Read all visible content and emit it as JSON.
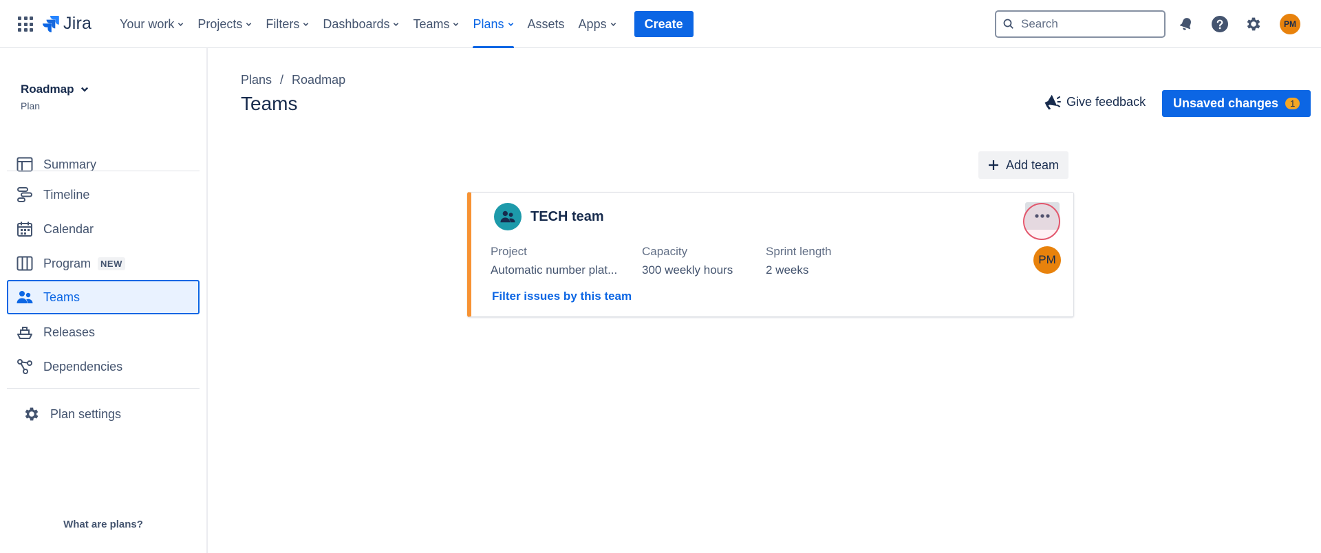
{
  "nav": {
    "logo_text": "Jira",
    "items": [
      {
        "label": "Your work",
        "has_dropdown": true
      },
      {
        "label": "Projects",
        "has_dropdown": true
      },
      {
        "label": "Filters",
        "has_dropdown": true
      },
      {
        "label": "Dashboards",
        "has_dropdown": true
      },
      {
        "label": "Teams",
        "has_dropdown": true
      },
      {
        "label": "Plans",
        "has_dropdown": true,
        "active": true
      },
      {
        "label": "Assets",
        "has_dropdown": false
      },
      {
        "label": "Apps",
        "has_dropdown": true
      }
    ],
    "create_label": "Create",
    "search_placeholder": "Search",
    "user_initials": "PM",
    "icons": [
      "notifications-icon",
      "help-icon",
      "settings-icon"
    ]
  },
  "sidebar": {
    "title": "Roadmap",
    "subtitle": "Plan",
    "items": [
      {
        "label": "Summary",
        "icon": "summary-icon"
      },
      {
        "label": "Timeline",
        "icon": "timeline-icon"
      },
      {
        "label": "Calendar",
        "icon": "calendar-icon"
      },
      {
        "label": "Program",
        "icon": "program-icon",
        "badge": "NEW"
      },
      {
        "label": "Teams",
        "icon": "teams-icon",
        "selected": true
      },
      {
        "label": "Releases",
        "icon": "releases-icon"
      },
      {
        "label": "Dependencies",
        "icon": "dependencies-icon"
      }
    ],
    "settings_label": "Plan settings",
    "footer_link": "What are plans?"
  },
  "main": {
    "breadcrumb": [
      "Plans",
      "Roadmap"
    ],
    "breadcrumb_separator": "/",
    "title": "Teams",
    "feedback_label": "Give feedback",
    "unsaved_label": "Unsaved changes",
    "unsaved_count": "1",
    "add_team_label": "Add team",
    "team": {
      "name": "TECH team",
      "project_label": "Project",
      "project_value": "Automatic number plat...",
      "capacity_label": "Capacity",
      "capacity_value": "300 weekly hours",
      "sprint_label": "Sprint length",
      "sprint_value": "2 weeks",
      "member_initials": "PM",
      "filter_link": "Filter issues by this team"
    }
  },
  "colors": {
    "brand_blue": "#0c66e4",
    "team_accent": "#f79233",
    "avatar_orange": "#e8820c",
    "team_icon_teal": "#1d9aaa"
  }
}
